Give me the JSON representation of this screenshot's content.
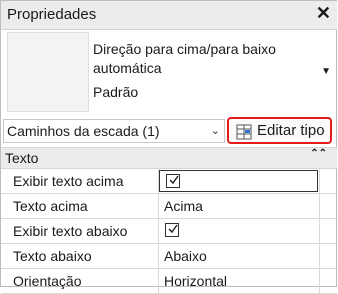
{
  "panel": {
    "title": "Propriedades"
  },
  "type_selector": {
    "name": "Direção para cima/para baixo automática",
    "subtitle": "Padrão"
  },
  "instance_filter": {
    "selected": "Caminhos da escada (1)"
  },
  "edit_type_button": {
    "label": "Editar tipo"
  },
  "properties": {
    "group": "Texto",
    "rows": [
      {
        "name": "Exibir texto acima",
        "checked": true
      },
      {
        "name": "Texto acima",
        "value": "Acima"
      },
      {
        "name": "Exibir texto abaixo",
        "checked": true
      },
      {
        "name": "Texto abaixo",
        "value": "Abaixo"
      },
      {
        "name": "Orientação",
        "value": "Horizontal"
      }
    ]
  },
  "colors": {
    "highlight_border": "#e21b1b"
  }
}
